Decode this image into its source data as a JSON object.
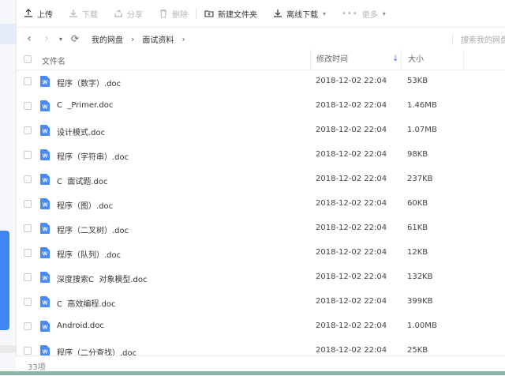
{
  "toolbar": {
    "upload": "上传",
    "download": "下载",
    "share": "分享",
    "delete": "删除",
    "new_folder": "新建文件夹",
    "offline_download": "离线下载",
    "more": "更多"
  },
  "nav": {
    "breadcrumb": [
      "我的网盘",
      "面试资料"
    ],
    "search_placeholder": "搜索我的网盘"
  },
  "columns": {
    "name": "文件名",
    "time": "修改时间",
    "size": "大小"
  },
  "files": [
    {
      "name": "程序（数字）.doc",
      "time": "2018-12-02 22:04",
      "size": "53KB"
    },
    {
      "name": "C  _Primer.doc",
      "time": "2018-12-02 22:04",
      "size": "1.46MB"
    },
    {
      "name": "设计模式.doc",
      "time": "2018-12-02 22:04",
      "size": "1.07MB"
    },
    {
      "name": "程序（字符串）.doc",
      "time": "2018-12-02 22:04",
      "size": "98KB"
    },
    {
      "name": "C  面试题.doc",
      "time": "2018-12-02 22:04",
      "size": "237KB"
    },
    {
      "name": "程序（图）.doc",
      "time": "2018-12-02 22:04",
      "size": "60KB"
    },
    {
      "name": "程序（二叉树）.doc",
      "time": "2018-12-02 22:04",
      "size": "61KB"
    },
    {
      "name": "程序（队列）.doc",
      "time": "2018-12-02 22:04",
      "size": "12KB"
    },
    {
      "name": "深度搜索C  对象模型.doc",
      "time": "2018-12-02 22:04",
      "size": "132KB"
    },
    {
      "name": "C  高效编程.doc",
      "time": "2018-12-02 22:04",
      "size": "399KB"
    },
    {
      "name": "Android.doc",
      "time": "2018-12-02 22:04",
      "size": "1.00MB"
    },
    {
      "name": "程序（二分查找）.doc",
      "time": "2018-12-02 22:04",
      "size": "25KB"
    }
  ],
  "status": {
    "count": "33项"
  },
  "colors": {
    "accent": "#3b7de0",
    "doc_icon": "#4a8af4"
  }
}
